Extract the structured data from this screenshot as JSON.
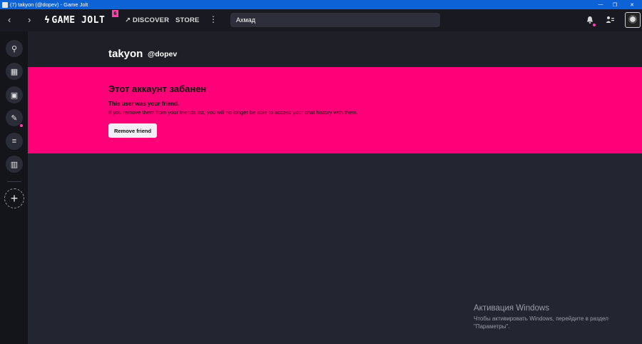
{
  "window": {
    "title": "(7) takyon (@dopev) - Game Jolt",
    "minimize": "—",
    "maximize": "❐",
    "close": "✕"
  },
  "topbar": {
    "back": "‹",
    "forward": "›",
    "logo": "GAME JOLT",
    "logo_bolt": "ϟ",
    "badge": "6",
    "discover_icon": "↗",
    "discover": "DISCOVER",
    "store": "STORE",
    "more": "⋮",
    "search_value": "Ахмад",
    "bell_icon": "bell-icon",
    "friends_icon": "friends-icon",
    "accent": "#ff3fac"
  },
  "sidebar": {
    "items": [
      {
        "name": "joystick",
        "glyph": "⚲"
      },
      {
        "name": "store",
        "glyph": "▦"
      },
      {
        "name": "backpack",
        "glyph": "▣"
      },
      {
        "name": "broadcast",
        "glyph": "✎"
      },
      {
        "name": "chat",
        "glyph": "≡"
      },
      {
        "name": "library",
        "glyph": "▥"
      }
    ],
    "add": "+"
  },
  "profile": {
    "name": "takyon",
    "handle": "@dopev"
  },
  "ban": {
    "title": "Этот аккаунт забанен",
    "subtitle": "This user was your friend.",
    "text": "If you remove them from your friends list, you will no longer be able to access your chat history with them.",
    "button": "Remove friend",
    "color": "#ff0079"
  },
  "activation": {
    "title": "Активация Windows",
    "line1": "Чтобы активировать Windows, перейдите в раздел",
    "line2": "\"Параметры\"."
  }
}
